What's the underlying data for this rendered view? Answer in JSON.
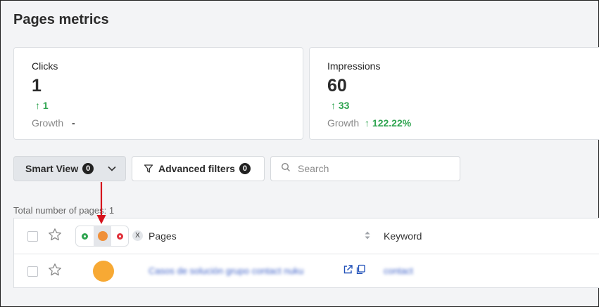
{
  "page": {
    "title": "Pages metrics"
  },
  "metrics": {
    "clicks": {
      "label": "Clicks",
      "value": "1",
      "delta": "1",
      "growth_label": "Growth",
      "growth_value": "-"
    },
    "impressions": {
      "label": "Impressions",
      "value": "60",
      "delta": "33",
      "growth_label": "Growth",
      "growth_value": "122.22%"
    }
  },
  "toolbar": {
    "smart_view_label": "Smart View",
    "smart_view_count": "0",
    "advanced_filters_label": "Advanced filters",
    "advanced_filters_count": "0",
    "search_placeholder": "Search"
  },
  "summary": {
    "total_pages": "Total number of pages: 1"
  },
  "table": {
    "status_clear": "X",
    "columns": {
      "pages": "Pages",
      "keyword": "Keyword"
    },
    "rows": [
      {
        "page": "Casos de solución grupo contact nuku",
        "keyword": "contact"
      }
    ]
  },
  "colors": {
    "positive": "#2ea44f",
    "status_green": "#2ea44f",
    "status_orange": "#f0903a",
    "status_red": "#e0303a",
    "row_status": "#f7a934",
    "annotation_arrow": "#d6121c"
  },
  "icons": [
    "arrow-up-icon",
    "chevron-down-icon",
    "funnel-icon",
    "search-icon",
    "star-icon",
    "sort-icon",
    "external-link-icon",
    "copy-icon"
  ]
}
